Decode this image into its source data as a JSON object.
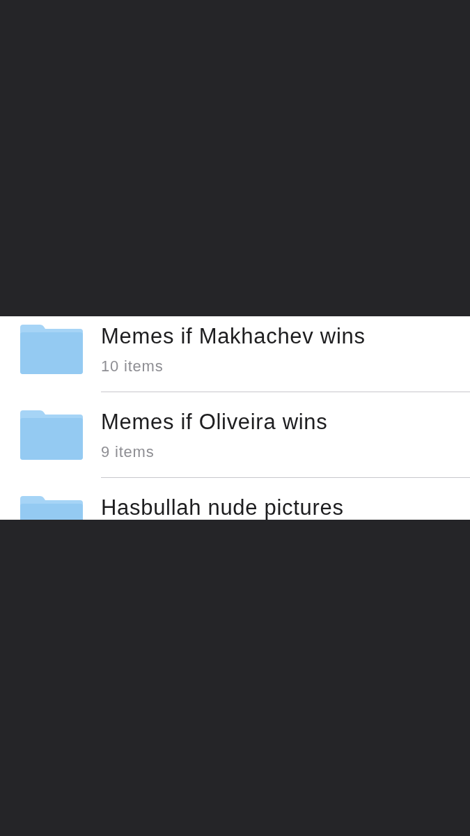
{
  "folders": [
    {
      "name": "Memes if Makhachev wins",
      "count": "10 items"
    },
    {
      "name": "Memes if Oliveira wins",
      "count": "9 items"
    },
    {
      "name": "Hasbullah nude pictures"
    }
  ]
}
